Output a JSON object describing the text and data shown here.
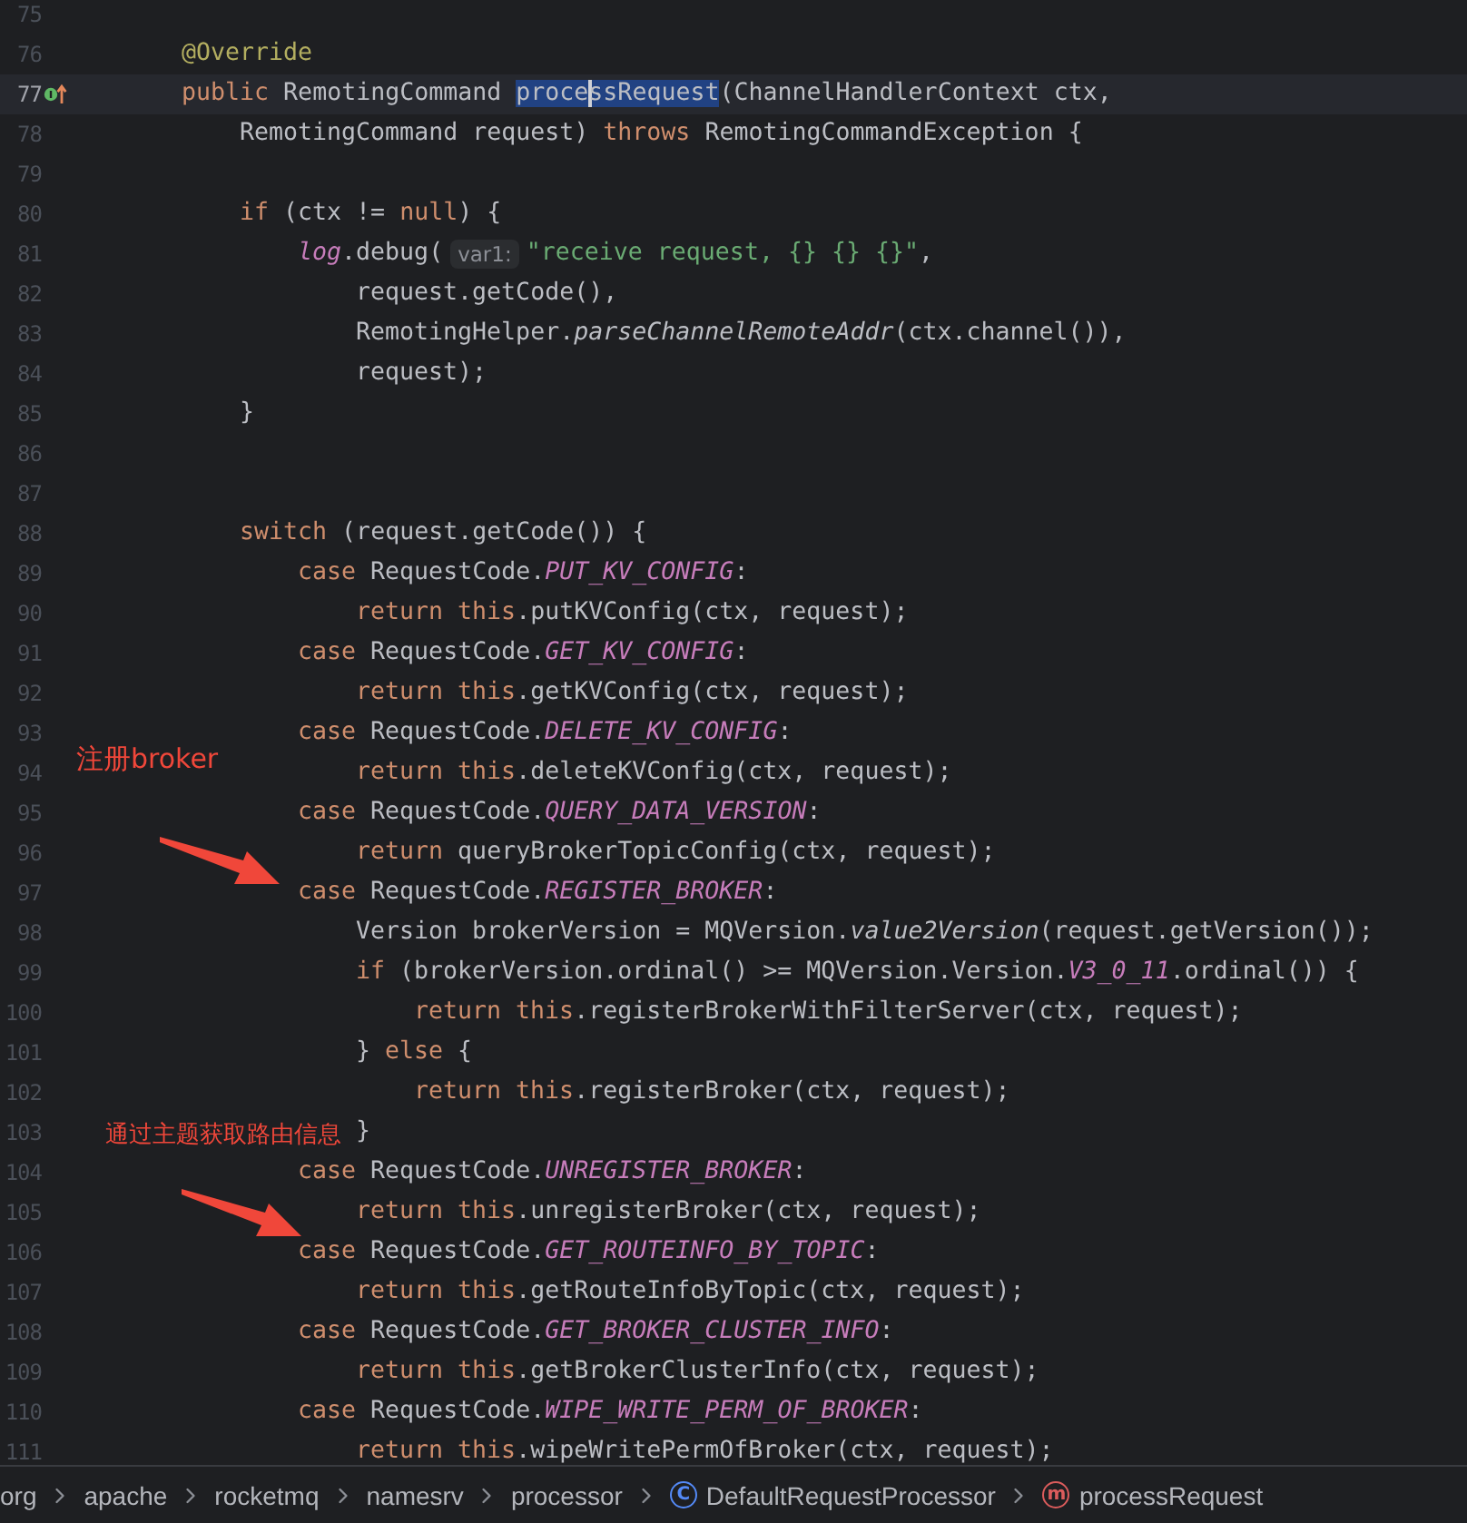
{
  "editor": {
    "lines": [
      {
        "number": "75",
        "current": false
      },
      {
        "number": "76",
        "current": false,
        "tokens": [
          {
            "kind": "a",
            "text": "        @Override"
          }
        ]
      },
      {
        "number": "77",
        "current": true,
        "overridden": true,
        "tokens": [
          {
            "kind": "k",
            "text": "        public"
          },
          {
            "kind": "t",
            "text": " RemotingCommand "
          },
          {
            "kind": "sel",
            "text": "proce"
          },
          {
            "kind": "sel",
            "text": "ssRequest",
            "caret": true
          },
          {
            "kind": "t",
            "text": "(ChannelHandlerContext ctx,"
          }
        ]
      },
      {
        "number": "78",
        "current": false,
        "tokens": [
          {
            "kind": "t",
            "text": "            RemotingCommand request) "
          },
          {
            "kind": "k",
            "text": "throws"
          },
          {
            "kind": "t",
            "text": " RemotingCommandException {"
          }
        ]
      },
      {
        "number": "79",
        "current": false
      },
      {
        "number": "80",
        "current": false,
        "tokens": [
          {
            "kind": "k",
            "text": "            if"
          },
          {
            "kind": "t",
            "text": " (ctx != "
          },
          {
            "kind": "k",
            "text": "null"
          },
          {
            "kind": "t",
            "text": ") {"
          }
        ]
      },
      {
        "number": "81",
        "current": false,
        "tokens": [
          {
            "kind": "c",
            "text": "                log"
          },
          {
            "kind": "t",
            "text": ".debug("
          },
          {
            "kind": "h",
            "text": "var1:"
          },
          {
            "kind": "s",
            "text": "\"receive request, {} {} {}\""
          },
          {
            "kind": "t",
            "text": ","
          }
        ]
      },
      {
        "number": "82",
        "current": false,
        "tokens": [
          {
            "kind": "t",
            "text": "                    request.getCode(),"
          }
        ]
      },
      {
        "number": "83",
        "current": false,
        "tokens": [
          {
            "kind": "t",
            "text": "                    RemotingHelper."
          },
          {
            "kind": "i",
            "text": "parseChannelRemoteAddr"
          },
          {
            "kind": "t",
            "text": "(ctx.channel()),"
          }
        ]
      },
      {
        "number": "84",
        "current": false,
        "tokens": [
          {
            "kind": "t",
            "text": "                    request);"
          }
        ]
      },
      {
        "number": "85",
        "current": false,
        "tokens": [
          {
            "kind": "t",
            "text": "            }"
          }
        ]
      },
      {
        "number": "86",
        "current": false
      },
      {
        "number": "87",
        "current": false
      },
      {
        "number": "88",
        "current": false,
        "tokens": [
          {
            "kind": "k",
            "text": "            switch"
          },
          {
            "kind": "t",
            "text": " (request.getCode()) {"
          }
        ]
      },
      {
        "number": "89",
        "current": false,
        "tokens": [
          {
            "kind": "k",
            "text": "                case"
          },
          {
            "kind": "t",
            "text": " RequestCode."
          },
          {
            "kind": "c",
            "text": "PUT_KV_CONFIG"
          },
          {
            "kind": "t",
            "text": ":"
          }
        ]
      },
      {
        "number": "90",
        "current": false,
        "tokens": [
          {
            "kind": "k",
            "text": "                    return this"
          },
          {
            "kind": "t",
            "text": ".putKVConfig(ctx, request);"
          }
        ]
      },
      {
        "number": "91",
        "current": false,
        "tokens": [
          {
            "kind": "k",
            "text": "                case"
          },
          {
            "kind": "t",
            "text": " RequestCode."
          },
          {
            "kind": "c",
            "text": "GET_KV_CONFIG"
          },
          {
            "kind": "t",
            "text": ":"
          }
        ]
      },
      {
        "number": "92",
        "current": false,
        "tokens": [
          {
            "kind": "k",
            "text": "                    return this"
          },
          {
            "kind": "t",
            "text": ".getKVConfig(ctx, request);"
          }
        ]
      },
      {
        "number": "93",
        "current": false,
        "tokens": [
          {
            "kind": "k",
            "text": "                case"
          },
          {
            "kind": "t",
            "text": " RequestCode."
          },
          {
            "kind": "c",
            "text": "DELETE_KV_CONFIG"
          },
          {
            "kind": "t",
            "text": ":"
          }
        ]
      },
      {
        "number": "94",
        "current": false,
        "tokens": [
          {
            "kind": "k",
            "text": "                    return this"
          },
          {
            "kind": "t",
            "text": ".deleteKVConfig(ctx, request);"
          }
        ]
      },
      {
        "number": "95",
        "current": false,
        "tokens": [
          {
            "kind": "k",
            "text": "                case"
          },
          {
            "kind": "t",
            "text": " RequestCode."
          },
          {
            "kind": "c",
            "text": "QUERY_DATA_VERSION"
          },
          {
            "kind": "t",
            "text": ":"
          }
        ]
      },
      {
        "number": "96",
        "current": false,
        "tokens": [
          {
            "kind": "k",
            "text": "                    return"
          },
          {
            "kind": "t",
            "text": " queryBrokerTopicConfig(ctx, request);"
          }
        ]
      },
      {
        "number": "97",
        "current": false,
        "tokens": [
          {
            "kind": "k",
            "text": "                case"
          },
          {
            "kind": "t",
            "text": " RequestCode."
          },
          {
            "kind": "c",
            "text": "REGISTER_BROKER"
          },
          {
            "kind": "t",
            "text": ":"
          }
        ]
      },
      {
        "number": "98",
        "current": false,
        "tokens": [
          {
            "kind": "t",
            "text": "                    Version brokerVersion = MQVersion."
          },
          {
            "kind": "i",
            "text": "value2Version"
          },
          {
            "kind": "t",
            "text": "(request.getVersion());"
          }
        ]
      },
      {
        "number": "99",
        "current": false,
        "tokens": [
          {
            "kind": "k",
            "text": "                    if"
          },
          {
            "kind": "t",
            "text": " (brokerVersion.ordinal() >= MQVersion.Version."
          },
          {
            "kind": "c",
            "text": "V3_0_11"
          },
          {
            "kind": "t",
            "text": ".ordinal()) {"
          }
        ]
      },
      {
        "number": "100",
        "current": false,
        "tokens": [
          {
            "kind": "k",
            "text": "                        return this"
          },
          {
            "kind": "t",
            "text": ".registerBrokerWithFilterServer(ctx, request);"
          }
        ]
      },
      {
        "number": "101",
        "current": false,
        "tokens": [
          {
            "kind": "t",
            "text": "                    } "
          },
          {
            "kind": "k",
            "text": "else"
          },
          {
            "kind": "t",
            "text": " {"
          }
        ]
      },
      {
        "number": "102",
        "current": false,
        "tokens": [
          {
            "kind": "k",
            "text": "                        return this"
          },
          {
            "kind": "t",
            "text": ".registerBroker(ctx, request);"
          }
        ]
      },
      {
        "number": "103",
        "current": false,
        "tokens": [
          {
            "kind": "t",
            "text": "                    }"
          }
        ]
      },
      {
        "number": "104",
        "current": false,
        "tokens": [
          {
            "kind": "k",
            "text": "                case"
          },
          {
            "kind": "t",
            "text": " RequestCode."
          },
          {
            "kind": "c",
            "text": "UNREGISTER_BROKER"
          },
          {
            "kind": "t",
            "text": ":"
          }
        ]
      },
      {
        "number": "105",
        "current": false,
        "tokens": [
          {
            "kind": "k",
            "text": "                    return this"
          },
          {
            "kind": "t",
            "text": ".unregisterBroker(ctx, request);"
          }
        ]
      },
      {
        "number": "106",
        "current": false,
        "tokens": [
          {
            "kind": "k",
            "text": "                case"
          },
          {
            "kind": "t",
            "text": " RequestCode."
          },
          {
            "kind": "c",
            "text": "GET_ROUTEINFO_BY_TOPIC"
          },
          {
            "kind": "t",
            "text": ":"
          }
        ]
      },
      {
        "number": "107",
        "current": false,
        "tokens": [
          {
            "kind": "k",
            "text": "                    return this"
          },
          {
            "kind": "t",
            "text": ".getRouteInfoByTopic(ctx, request);"
          }
        ]
      },
      {
        "number": "108",
        "current": false,
        "tokens": [
          {
            "kind": "k",
            "text": "                case"
          },
          {
            "kind": "t",
            "text": " RequestCode."
          },
          {
            "kind": "c",
            "text": "GET_BROKER_CLUSTER_INFO"
          },
          {
            "kind": "t",
            "text": ":"
          }
        ]
      },
      {
        "number": "109",
        "current": false,
        "tokens": [
          {
            "kind": "k",
            "text": "                    return this"
          },
          {
            "kind": "t",
            "text": ".getBrokerClusterInfo(ctx, request);"
          }
        ]
      },
      {
        "number": "110",
        "current": false,
        "tokens": [
          {
            "kind": "k",
            "text": "                case"
          },
          {
            "kind": "t",
            "text": " RequestCode."
          },
          {
            "kind": "c",
            "text": "WIPE_WRITE_PERM_OF_BROKER"
          },
          {
            "kind": "t",
            "text": ":"
          }
        ]
      },
      {
        "number": "111",
        "current": false,
        "tokens": [
          {
            "kind": "k",
            "text": "                    return this"
          },
          {
            "kind": "t",
            "text": ".wipeWritePermOfBroker(ctx, request);"
          }
        ]
      }
    ]
  },
  "annotations": [
    {
      "text": "注册broker"
    },
    {
      "text": "通过主题获取路由信息"
    }
  ],
  "breadcrumb": [
    {
      "kind": "package",
      "label": "org"
    },
    {
      "kind": "package",
      "label": "apache"
    },
    {
      "kind": "package",
      "label": "rocketmq"
    },
    {
      "kind": "package",
      "label": "namesrv"
    },
    {
      "kind": "package",
      "label": "processor"
    },
    {
      "kind": "class",
      "icon_letter": "C",
      "label": "DefaultRequestProcessor"
    },
    {
      "kind": "method",
      "icon_letter": "m",
      "label": "processRequest"
    }
  ]
}
